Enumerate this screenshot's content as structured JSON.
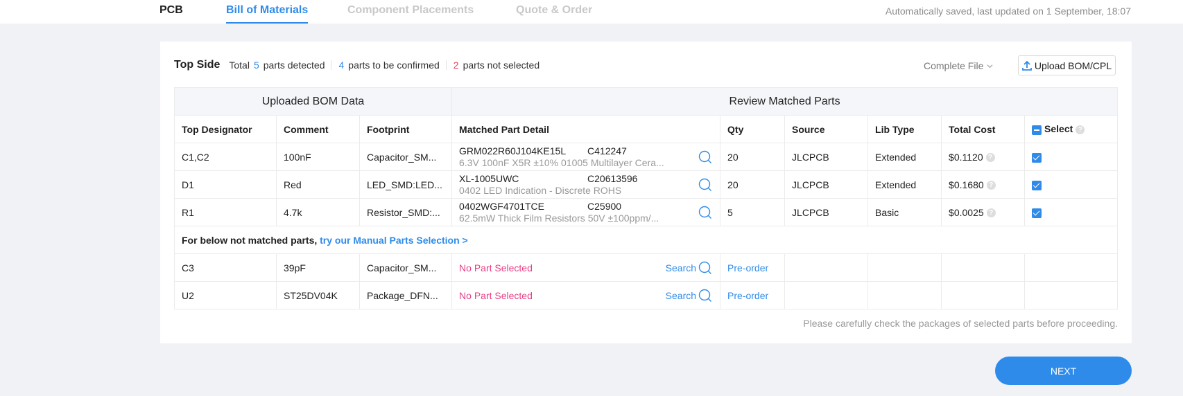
{
  "header": {
    "tabs": [
      {
        "label": "PCB",
        "state": "default"
      },
      {
        "label": "Bill of Materials",
        "state": "active"
      },
      {
        "label": "Component Placements",
        "state": "disabled"
      },
      {
        "label": "Quote & Order",
        "state": "disabled"
      }
    ],
    "saved_status": "Automatically saved, last updated on 1 September, 18:07"
  },
  "summary": {
    "title": "Top Side",
    "total_prefix": "Total",
    "total_count": "5",
    "total_suffix": "parts detected",
    "confirm_count": "4",
    "confirm_suffix": "parts to be confirmed",
    "not_selected_count": "2",
    "not_selected_suffix": "parts not selected"
  },
  "toolbar": {
    "complete_file_label": "Complete File",
    "upload_label": "Upload BOM/CPL"
  },
  "table": {
    "group_headers": [
      "Uploaded BOM Data",
      "Review Matched Parts"
    ],
    "columns": [
      "Top Designator",
      "Comment",
      "Footprint",
      "Matched Part Detail",
      "Qty",
      "Source",
      "Lib Type",
      "Total Cost",
      "Select"
    ],
    "matched_rows": [
      {
        "designator": "C1,C2",
        "comment": "100nF",
        "footprint": "Capacitor_SM...",
        "mpn": "GRM022R60J104KE15L",
        "lcsc": "C412247",
        "description": "6.3V 100nF X5R ±10% 01005 Multilayer Cera...",
        "qty": "20",
        "source": "JLCPCB",
        "lib_type": "Extended",
        "total_cost": "$0.1120",
        "selected": true
      },
      {
        "designator": "D1",
        "comment": "Red",
        "footprint": "LED_SMD:LED...",
        "mpn": "XL-1005UWC",
        "lcsc": "C20613596",
        "description": "0402 LED Indication - Discrete ROHS",
        "qty": "20",
        "source": "JLCPCB",
        "lib_type": "Extended",
        "total_cost": "$0.1680",
        "selected": true
      },
      {
        "designator": "R1",
        "comment": "4.7k",
        "footprint": "Resistor_SMD:...",
        "mpn": "0402WGF4701TCE",
        "lcsc": "C25900",
        "description": "62.5mW Thick Film Resistors 50V ±100ppm/...",
        "qty": "5",
        "source": "JLCPCB",
        "lib_type": "Basic",
        "total_cost": "$0.0025",
        "selected": true
      }
    ],
    "note_prefix": "For below not matched parts,",
    "note_link": "try our Manual Parts Selection >",
    "unmatched_rows": [
      {
        "designator": "C3",
        "comment": "39pF",
        "footprint": "Capacitor_SM...",
        "status": "No Part Selected",
        "search_label": "Search",
        "preorder_label": "Pre-order"
      },
      {
        "designator": "U2",
        "comment": "ST25DV04K",
        "footprint": "Package_DFN...",
        "status": "No Part Selected",
        "search_label": "Search",
        "preorder_label": "Pre-order"
      }
    ]
  },
  "footer_note": "Please carefully check the packages of selected parts before proceeding.",
  "next_label": "NEXT",
  "colors": {
    "accent": "#2e8bea",
    "danger": "#ee3d55",
    "no_part": "#ea3d86",
    "background": "#f0f2f6"
  }
}
